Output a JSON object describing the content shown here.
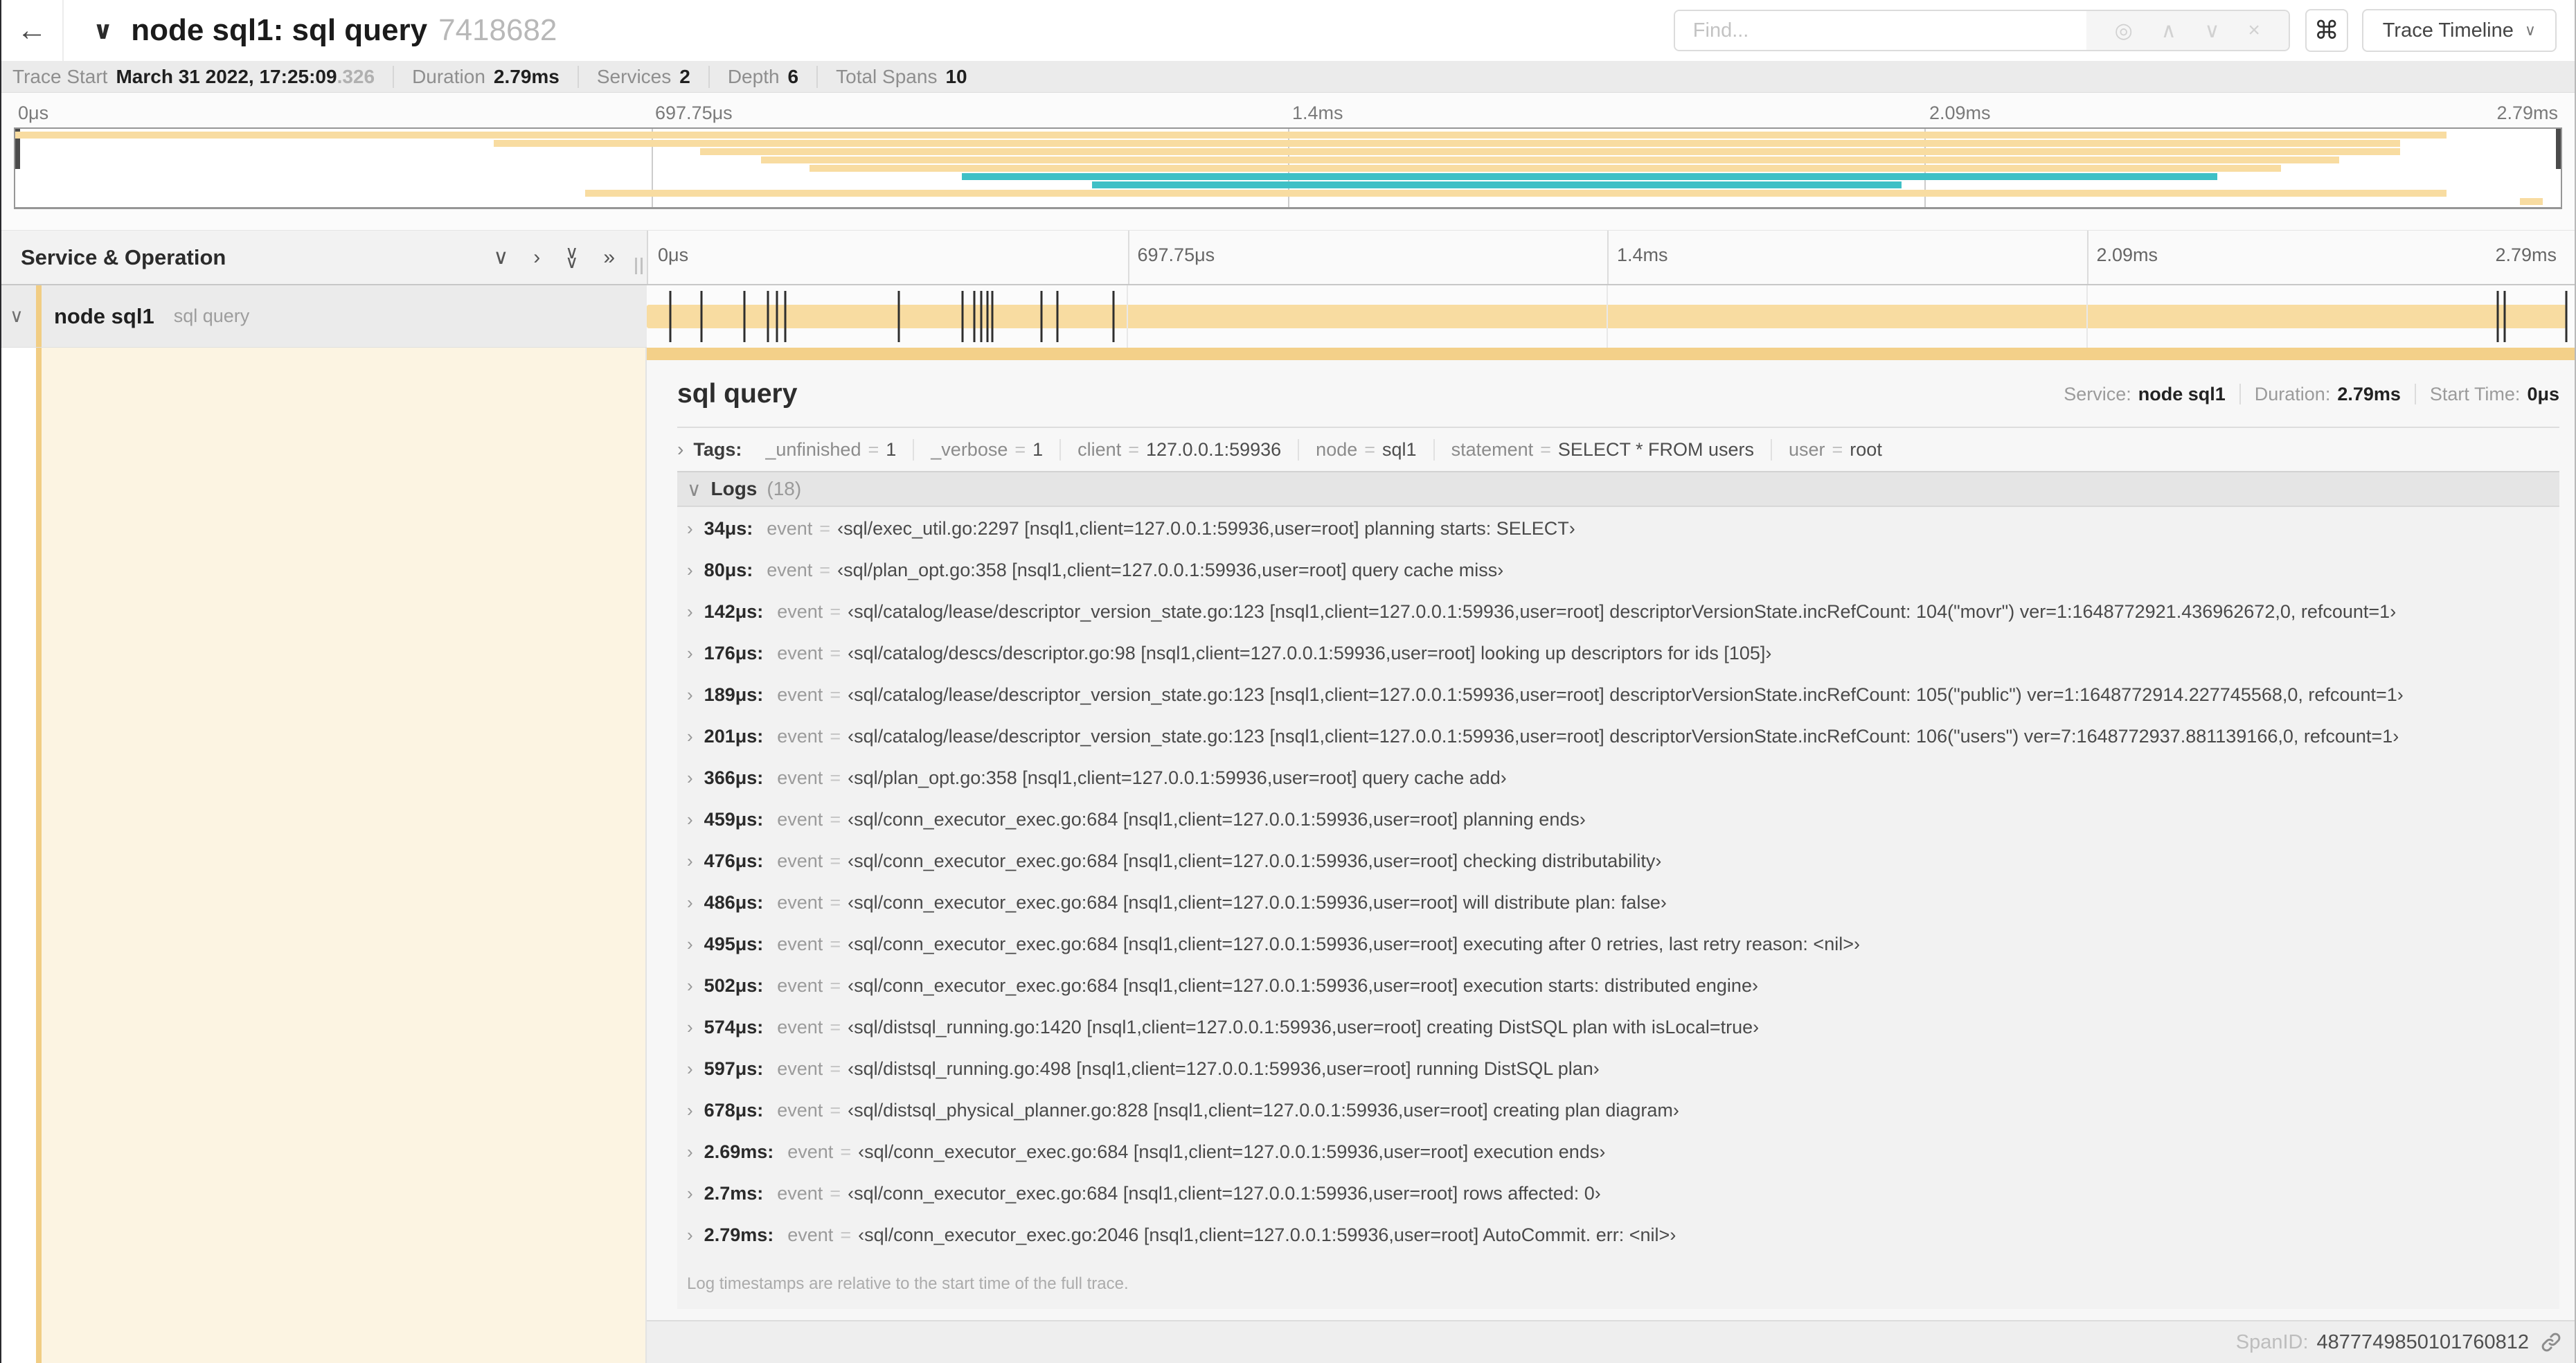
{
  "colors": {
    "span_orange": "#f8dca1",
    "accent_orange": "#f1cd84",
    "detail_bar_orange": "#f3d089",
    "teal": "#3fc0c6",
    "cream": "#fcf4e2"
  },
  "icons": {
    "back_arrow": "←",
    "caret_down": "∨",
    "chevron_right": "›",
    "double_chevron_right": "»",
    "target": "◎",
    "up": "∧",
    "down": "∨",
    "close": "×",
    "equals": "="
  },
  "header": {
    "title": "node sql1: sql query",
    "trace_id": "7418682",
    "find_placeholder": "Find...",
    "command_glyph": "⌘",
    "trace_timeline_label": "Trace Timeline"
  },
  "trace_meta": {
    "start_label": "Trace Start",
    "start_value": "March 31 2022, 17:25:09",
    "start_fraction": ".326",
    "duration_label": "Duration",
    "duration_value": "2.79ms",
    "services_label": "Services",
    "services_value": "2",
    "depth_label": "Depth",
    "depth_value": "6",
    "spans_label": "Total Spans",
    "spans_value": "10"
  },
  "timeline": {
    "ticks": [
      "0μs",
      "697.75μs",
      "1.4ms",
      "2.09ms",
      "2.79ms"
    ],
    "gridlines": [
      25,
      50,
      75
    ],
    "duration_us": 2790
  },
  "minimap": {
    "bars": [
      {
        "start": 0,
        "end": 95.5,
        "color": "span_orange"
      },
      {
        "start": 18.8,
        "end": 93.7,
        "color": "span_orange"
      },
      {
        "start": 26.9,
        "end": 93.7,
        "color": "span_orange"
      },
      {
        "start": 29.3,
        "end": 91.3,
        "color": "span_orange"
      },
      {
        "start": 31.2,
        "end": 89.0,
        "color": "span_orange"
      },
      {
        "start": 37.2,
        "end": 86.5,
        "color": "teal"
      },
      {
        "start": 42.3,
        "end": 74.1,
        "color": "teal"
      },
      {
        "start": 22.4,
        "end": 95.5,
        "color": "span_orange"
      },
      {
        "start": 98.4,
        "end": 99.3,
        "color": "span_orange"
      }
    ]
  },
  "gantt": {
    "header_label": "Service & Operation",
    "service": "node sql1",
    "operation": "sql query"
  },
  "detail": {
    "title": "sql query",
    "service_label": "Service:",
    "service_value": "node sql1",
    "duration_label": "Duration:",
    "duration_value": "2.79ms",
    "start_label": "Start Time:",
    "start_value": "0μs",
    "tags_label": "Tags:",
    "tags": [
      {
        "key": "_unfinished",
        "value": "1"
      },
      {
        "key": "_verbose",
        "value": "1"
      },
      {
        "key": "client",
        "value": "127.0.0.1:59936"
      },
      {
        "key": "node",
        "value": "sql1"
      },
      {
        "key": "statement",
        "value": "SELECT * FROM users"
      },
      {
        "key": "user",
        "value": "root"
      }
    ],
    "logs_label": "Logs",
    "logs_count": "(18)",
    "log_key_label": "event",
    "logs": [
      {
        "t": "34μs",
        "t_us": 34,
        "value": "‹sql/exec_util.go:2297 [nsql1,client=127.0.0.1:59936,user=root] planning starts: SELECT›"
      },
      {
        "t": "80μs",
        "t_us": 80,
        "value": "‹sql/plan_opt.go:358 [nsql1,client=127.0.0.1:59936,user=root] query cache miss›"
      },
      {
        "t": "142μs",
        "t_us": 142,
        "value": "‹sql/catalog/lease/descriptor_version_state.go:123 [nsql1,client=127.0.0.1:59936,user=root] descriptorVersionState.incRefCount: 104(\"movr\") ver=1:1648772921.436962672,0, refcount=1›"
      },
      {
        "t": "176μs",
        "t_us": 176,
        "value": "‹sql/catalog/descs/descriptor.go:98 [nsql1,client=127.0.0.1:59936,user=root] looking up descriptors for ids [105]›"
      },
      {
        "t": "189μs",
        "t_us": 189,
        "value": "‹sql/catalog/lease/descriptor_version_state.go:123 [nsql1,client=127.0.0.1:59936,user=root] descriptorVersionState.incRefCount: 105(\"public\") ver=1:1648772914.227745568,0, refcount=1›"
      },
      {
        "t": "201μs",
        "t_us": 201,
        "value": "‹sql/catalog/lease/descriptor_version_state.go:123 [nsql1,client=127.0.0.1:59936,user=root] descriptorVersionState.incRefCount: 106(\"users\") ver=7:1648772937.881139166,0, refcount=1›"
      },
      {
        "t": "366μs",
        "t_us": 366,
        "value": "‹sql/plan_opt.go:358 [nsql1,client=127.0.0.1:59936,user=root] query cache add›"
      },
      {
        "t": "459μs",
        "t_us": 459,
        "value": "‹sql/conn_executor_exec.go:684 [nsql1,client=127.0.0.1:59936,user=root] planning ends›"
      },
      {
        "t": "476μs",
        "t_us": 476,
        "value": "‹sql/conn_executor_exec.go:684 [nsql1,client=127.0.0.1:59936,user=root] checking distributability›"
      },
      {
        "t": "486μs",
        "t_us": 486,
        "value": "‹sql/conn_executor_exec.go:684 [nsql1,client=127.0.0.1:59936,user=root] will distribute plan: false›"
      },
      {
        "t": "495μs",
        "t_us": 495,
        "value": "‹sql/conn_executor_exec.go:684 [nsql1,client=127.0.0.1:59936,user=root] executing after 0 retries, last retry reason: <nil>›"
      },
      {
        "t": "502μs",
        "t_us": 502,
        "value": "‹sql/conn_executor_exec.go:684 [nsql1,client=127.0.0.1:59936,user=root] execution starts: distributed engine›"
      },
      {
        "t": "574μs",
        "t_us": 574,
        "value": "‹sql/distsql_running.go:1420 [nsql1,client=127.0.0.1:59936,user=root] creating DistSQL plan with isLocal=true›"
      },
      {
        "t": "597μs",
        "t_us": 597,
        "value": "‹sql/distsql_running.go:498 [nsql1,client=127.0.0.1:59936,user=root] running DistSQL plan›"
      },
      {
        "t": "678μs",
        "t_us": 678,
        "value": "‹sql/distsql_physical_planner.go:828 [nsql1,client=127.0.0.1:59936,user=root] creating plan diagram›"
      },
      {
        "t": "2.69ms",
        "t_us": 2690,
        "value": "‹sql/conn_executor_exec.go:684 [nsql1,client=127.0.0.1:59936,user=root] execution ends›"
      },
      {
        "t": "2.7ms",
        "t_us": 2700,
        "value": "‹sql/conn_executor_exec.go:684 [nsql1,client=127.0.0.1:59936,user=root] rows affected: 0›"
      },
      {
        "t": "2.79ms",
        "t_us": 2790,
        "value": "‹sql/conn_executor_exec.go:2046 [nsql1,client=127.0.0.1:59936,user=root] AutoCommit. err: <nil>›"
      }
    ],
    "footnote": "Log timestamps are relative to the start time of the full trace.",
    "span_id_label": "SpanID:",
    "span_id_value": "4877749850101760812"
  }
}
